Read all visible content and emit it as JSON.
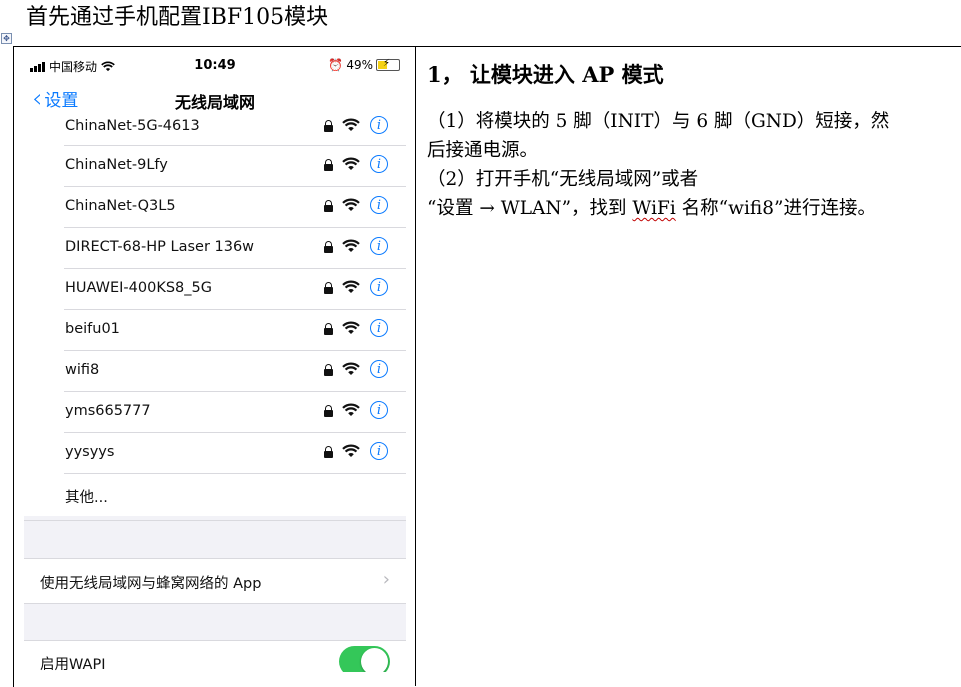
{
  "doc": {
    "title": "首先通过手机配置IBF105模块",
    "anchor_glyph": "✥"
  },
  "phone": {
    "status": {
      "carrier": "中国移动",
      "time": "10:49",
      "battery": "49%",
      "battery_level": 0.49
    },
    "nav": {
      "back_label": "设置",
      "title": "无线局域网"
    },
    "networks": [
      {
        "name": "ChinaNet-5G-4613",
        "locked": true
      },
      {
        "name": "ChinaNet-9Lfy",
        "locked": true
      },
      {
        "name": "ChinaNet-Q3L5",
        "locked": true
      },
      {
        "name": "DIRECT-68-HP Laser 136w",
        "locked": true
      },
      {
        "name": "HUAWEI-400KS8_5G",
        "locked": true
      },
      {
        "name": "beifu01",
        "locked": true
      },
      {
        "name": "wifi8",
        "locked": true
      },
      {
        "name": "yms665777",
        "locked": true
      },
      {
        "name": "yysyys",
        "locked": true
      }
    ],
    "other_label": "其他...",
    "apps_label": "使用无线局域网与蜂窝网络的 App",
    "wapi_label": "启用WAPI",
    "wapi_enabled": true,
    "accent_color": "#0a7aff",
    "toggle_color": "#34c759"
  },
  "instructions": {
    "heading": "1，  让模块进入 AP 模式",
    "line1": "（1）将模块的 5 脚（INIT）与 6 脚（GND）短接，然",
    "line2": "后接通电源。",
    "line3": "（2）打开手机“无线局域网”或者",
    "line4_prefix": "“设置 → WLAN”，找到 ",
    "line4_wifi": "WiFi",
    "line4_suffix": " 名称“wifi8”进行连接。"
  }
}
